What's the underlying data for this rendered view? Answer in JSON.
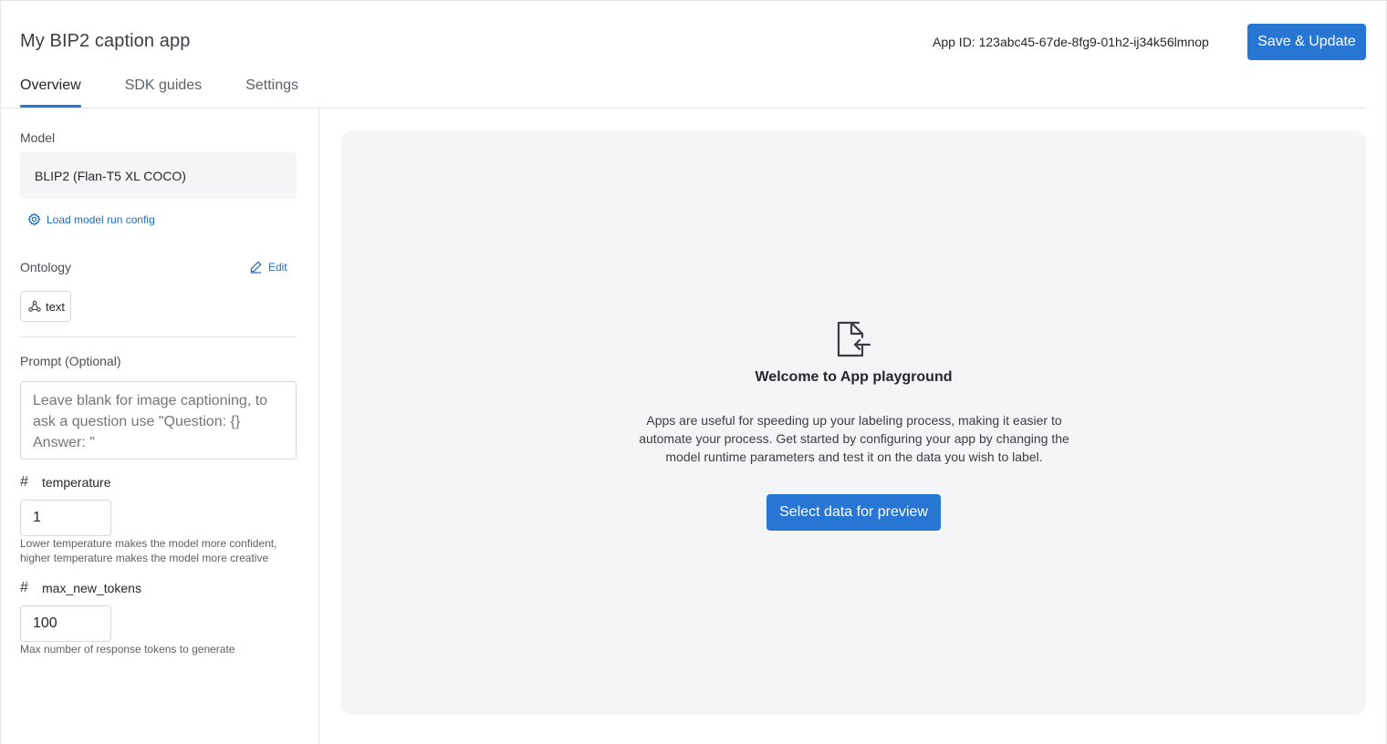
{
  "header": {
    "title": "My BIP2 caption app",
    "app_id": "App ID: 123abc45-67de-8fg9-01h2-ij34k56lmnop",
    "save_label": "Save & Update"
  },
  "tabs": [
    {
      "label": "Overview",
      "active": true
    },
    {
      "label": "SDK guides",
      "active": false
    },
    {
      "label": "Settings",
      "active": false
    }
  ],
  "sidebar": {
    "model_label": "Model",
    "model_value": "BLIP2 (Flan-T5 XL COCO)",
    "load_config_label": "Load model run config",
    "ontology_label": "Ontology",
    "edit_label": "Edit",
    "ontology_chip": "text",
    "prompt_label": "Prompt (Optional)",
    "prompt_placeholder": "Leave blank for image captioning, to ask a question use \"Question: {} Answer: \"",
    "temperature": {
      "label": "temperature",
      "value": "1",
      "help": "Lower temperature makes the model more confident, higher temperature makes the model more creative"
    },
    "max_new_tokens": {
      "label": "max_new_tokens",
      "value": "100",
      "help": "Max number of response tokens to generate"
    }
  },
  "playground": {
    "title": "Welcome to App playground",
    "description": "Apps are useful for speeding up your labeling process, making it easier to automate your process. Get started by configuring your app by changing the model runtime parameters and test it on the data you wish to label.",
    "button_label": "Select data for preview"
  },
  "colors": {
    "accent": "#2876d4",
    "link": "#1f6cc7",
    "panel_bg": "#f4f5f7"
  }
}
